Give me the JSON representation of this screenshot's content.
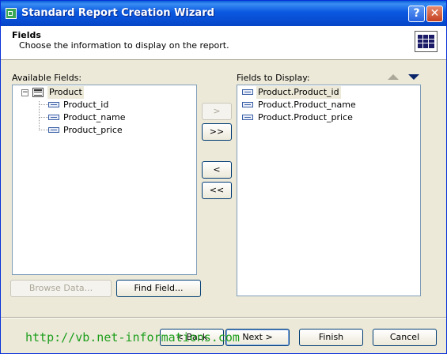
{
  "window": {
    "title": "Standard Report Creation Wizard",
    "help_glyph": "?",
    "close_glyph": "✕"
  },
  "header": {
    "title": "Fields",
    "subtitle": "Choose the information to display on the report."
  },
  "available": {
    "label": "Available Fields:",
    "root": {
      "label": "Product",
      "expander": "−"
    },
    "fields": [
      "Product_id",
      "Product_name",
      "Product_price"
    ]
  },
  "transfer": {
    "add": ">",
    "add_all": ">>",
    "remove": "<",
    "remove_all": "<<"
  },
  "display": {
    "label": "Fields to Display:",
    "fields": [
      "Product.Product_id",
      "Product.Product_name",
      "Product.Product_price"
    ]
  },
  "actions": {
    "browse": "Browse Data...",
    "find": "Find Field..."
  },
  "footer": {
    "back": "< Back",
    "next": "Next >",
    "finish": "Finish",
    "cancel": "Cancel"
  },
  "watermark": "http://vb.net-informations.com"
}
